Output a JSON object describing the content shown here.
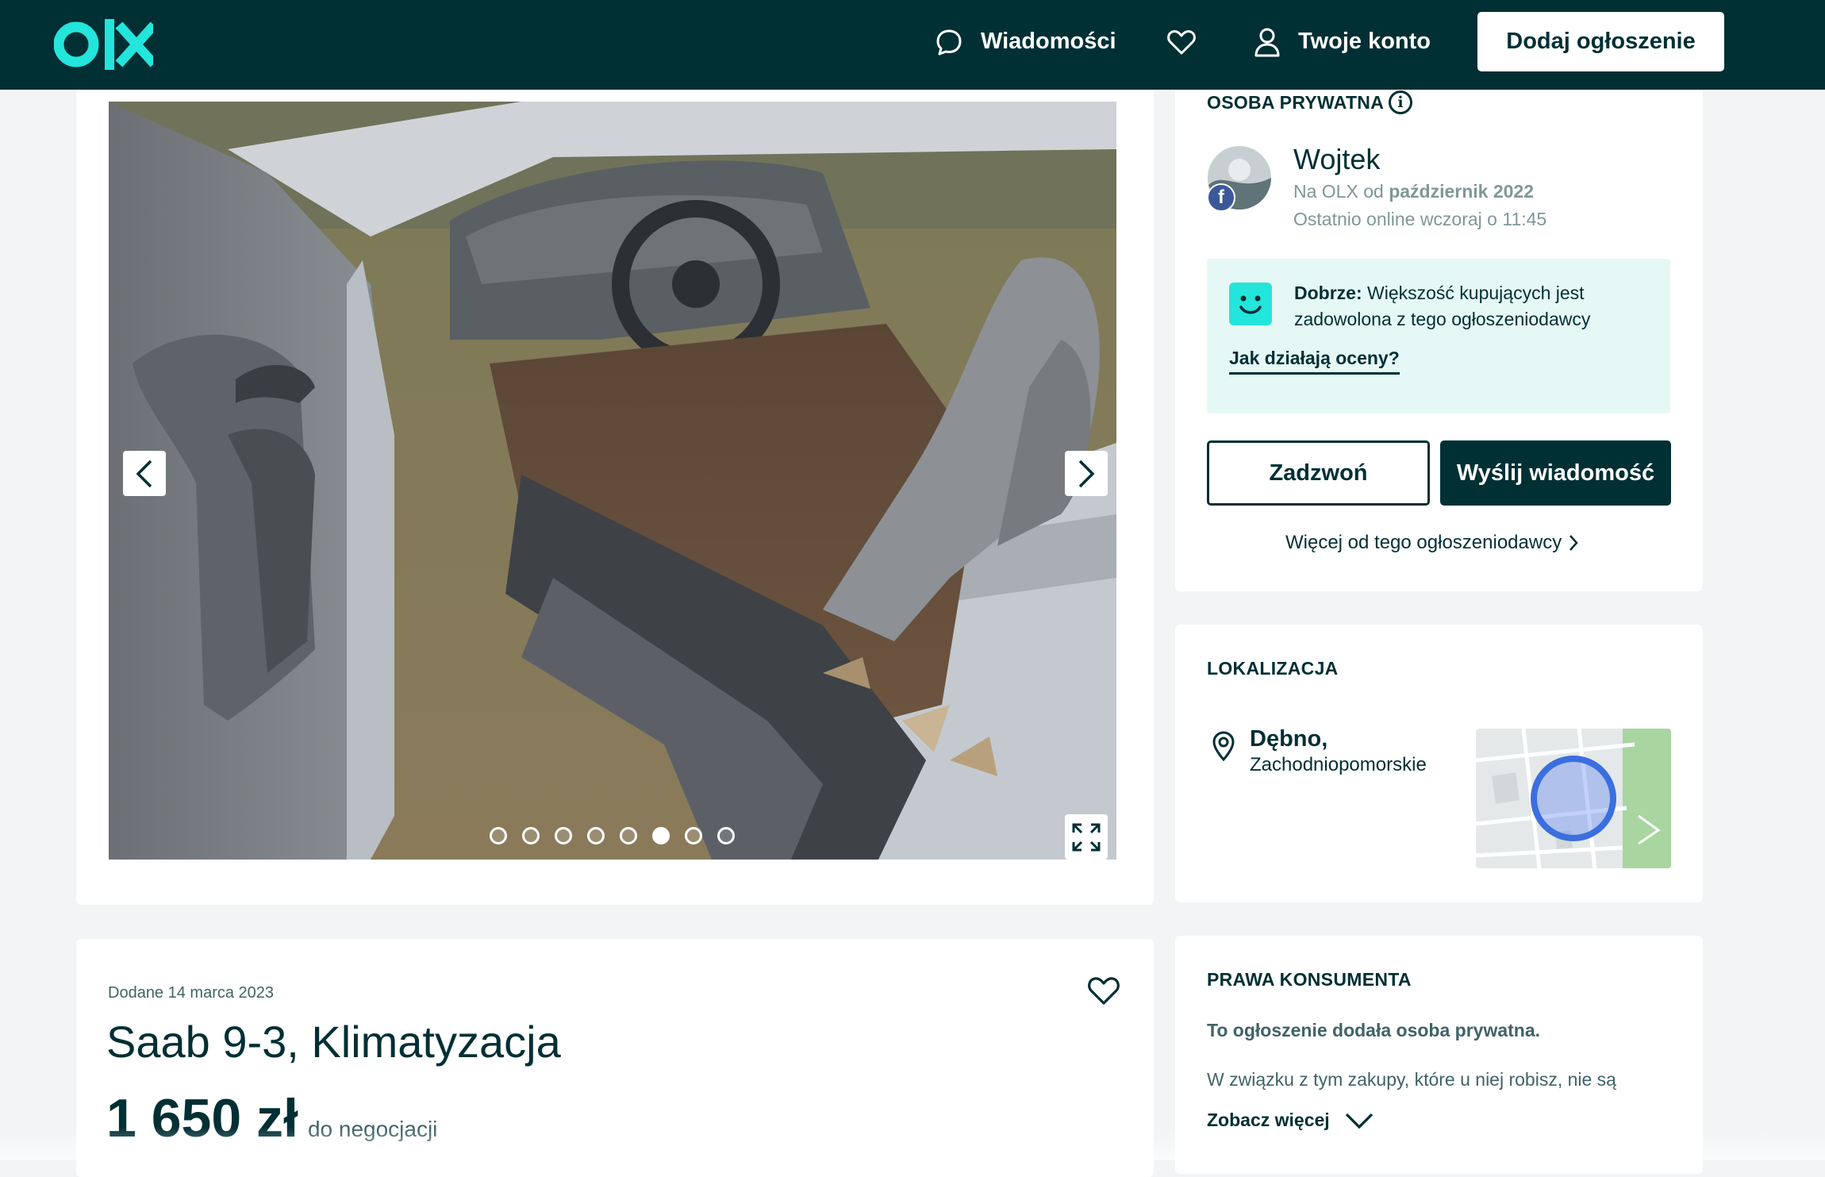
{
  "header": {
    "messages_label": "Wiadomości",
    "account_label": "Twoje konto",
    "add_listing_label": "Dodaj ogłoszenie"
  },
  "gallery": {
    "photo_count": 8,
    "active_photo_index": 5
  },
  "seller": {
    "section_title": "OSOBA PRYWATNA",
    "name": "Wojtek",
    "member_since_prefix": "Na OLX od ",
    "member_since": "październik 2022",
    "last_online": "Ostatnio online wczoraj o 11:45",
    "rating_label": "Dobrze:",
    "rating_text": " Większość kupujących jest zadowolona z tego ogłoszeniodawcy",
    "rating_link": "Jak działają oceny?",
    "call_button": "Zadzwoń",
    "message_button": "Wyślij wiadomość",
    "more_from_seller": "Więcej od tego ogłoszeniodawcy"
  },
  "location": {
    "section_title": "LOKALIZACJA",
    "city": "Dębno,",
    "region": "Zachodniopomorskie"
  },
  "consumer": {
    "section_title": "PRAWA KONSUMENTA",
    "bold_text": "To ogłoszenie dodała osoba prywatna.",
    "text": "W związku z tym zakupy, które u niej robisz, nie są",
    "see_more": "Zobacz więcej"
  },
  "listing": {
    "posted": "Dodane 14 marca 2023",
    "title": "Saab 9-3, Klimatyzacja",
    "price": "1 650 zł",
    "price_note": "do negocjacji"
  },
  "colors": {
    "brand_dark": "#002f34",
    "brand_accent": "#23e5db",
    "rating_bg": "#e6f8f6",
    "background": "#f2f4f5"
  }
}
